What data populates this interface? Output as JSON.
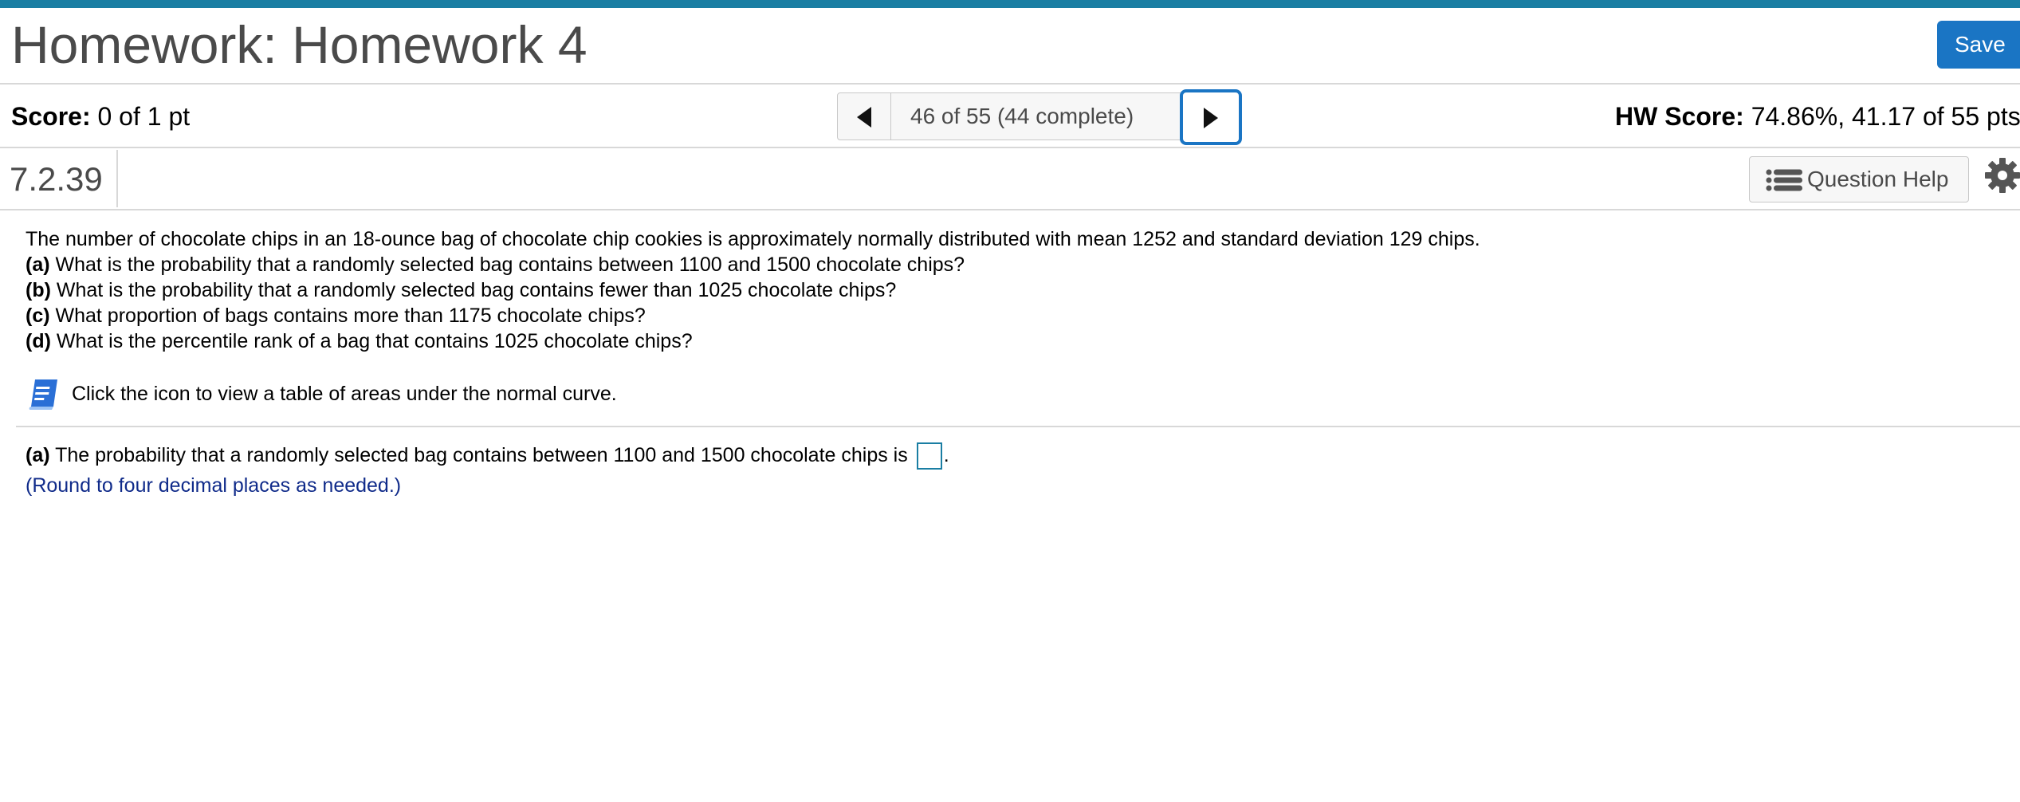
{
  "header": {
    "title": "Homework: Homework 4",
    "save_label": "Save"
  },
  "score": {
    "label": "Score:",
    "value": "0 of 1 pt"
  },
  "navigation": {
    "position_label": "46 of 55 (44 complete)",
    "prev_icon": "triangle-left-icon",
    "next_icon": "triangle-right-icon",
    "dropdown_icon": "caret-down-icon"
  },
  "hw_score": {
    "label": "HW Score:",
    "value": "74.86%, 41.17 of 55 pts"
  },
  "question": {
    "number": "7.2.39",
    "help_label": "Question Help",
    "help_icon": "list-icon",
    "settings_icon": "gear-icon",
    "intro": "The number of chocolate chips in an 18-ounce bag of chocolate chip cookies is approximately normally distributed with mean 1252 and standard deviation 129 chips.",
    "parts": [
      {
        "tag": "(a)",
        "text": "What is the probability that a randomly selected bag contains between 1100 and 1500 chocolate chips?"
      },
      {
        "tag": "(b)",
        "text": "What is the probability that a randomly selected bag contains fewer than 1025 chocolate chips?"
      },
      {
        "tag": "(c)",
        "text": "What proportion of bags contains more than 1175 chocolate chips?"
      },
      {
        "tag": "(d)",
        "text": "What is the percentile rank of a bag that contains 1025 chocolate chips?"
      }
    ],
    "table_icon": "book-icon",
    "table_text": "Click the icon to view a table of areas under the normal curve."
  },
  "answer": {
    "tag": "(a)",
    "text": "The probability that a randomly selected bag contains between 1100 and 1500 chocolate chips is",
    "value": "",
    "suffix": ".",
    "hint": "(Round to four decimal places as needed.)"
  },
  "colors": {
    "accent_bar": "#1a7ea3",
    "save_button": "#1a75c4",
    "hint_text": "#102b8a"
  }
}
